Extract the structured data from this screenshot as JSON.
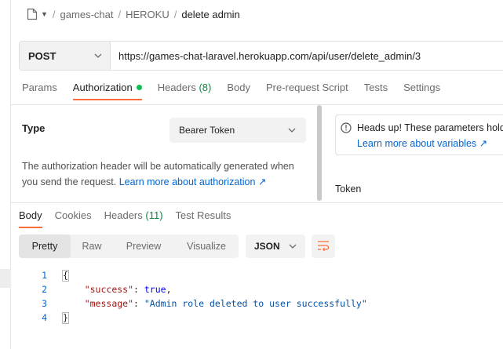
{
  "breadcrumb": {
    "collection": "games-chat",
    "folder": "HEROKU",
    "request": "delete admin",
    "separator": "/"
  },
  "request": {
    "method": "POST",
    "url": "https://games-chat-laravel.herokuapp.com/api/user/delete_admin/3"
  },
  "request_tabs": [
    {
      "label": "Params"
    },
    {
      "label": "Authorization",
      "active": true,
      "status_dot": true
    },
    {
      "label": "Headers",
      "count": "(8)"
    },
    {
      "label": "Body"
    },
    {
      "label": "Pre-request Script"
    },
    {
      "label": "Tests"
    },
    {
      "label": "Settings"
    }
  ],
  "auth": {
    "type_label": "Type",
    "type_value": "Bearer Token",
    "description": "The authorization header will be automatically generated when you send the request. ",
    "learn_more": "Learn more about authorization ↗",
    "notice_text": "Heads up! These parameters hold",
    "notice_link": "Learn more about variables ↗",
    "token_label": "Token"
  },
  "response_tabs": [
    {
      "label": "Body",
      "active": true
    },
    {
      "label": "Cookies"
    },
    {
      "label": "Headers",
      "count": "(11)"
    },
    {
      "label": "Test Results"
    }
  ],
  "view_modes": {
    "options": [
      "Pretty",
      "Raw",
      "Preview",
      "Visualize"
    ],
    "selected": "Pretty"
  },
  "format": "JSON",
  "response_body": {
    "line_numbers": [
      "1",
      "2",
      "3",
      "4"
    ],
    "open_brace": "{",
    "close_brace": "}",
    "fields": [
      {
        "key": "\"success\"",
        "value": "true",
        "kind": "bool",
        "trail": ","
      },
      {
        "key": "\"message\"",
        "value": "\"Admin role deleted to user successfully\"",
        "kind": "str",
        "trail": ""
      }
    ]
  },
  "colors": {
    "accent": "#ff6c37",
    "link": "#0265d2",
    "status_dot": "#0cbb52",
    "json_key": "#a31515",
    "json_string": "#0451a5",
    "json_bool": "#0000ff"
  }
}
